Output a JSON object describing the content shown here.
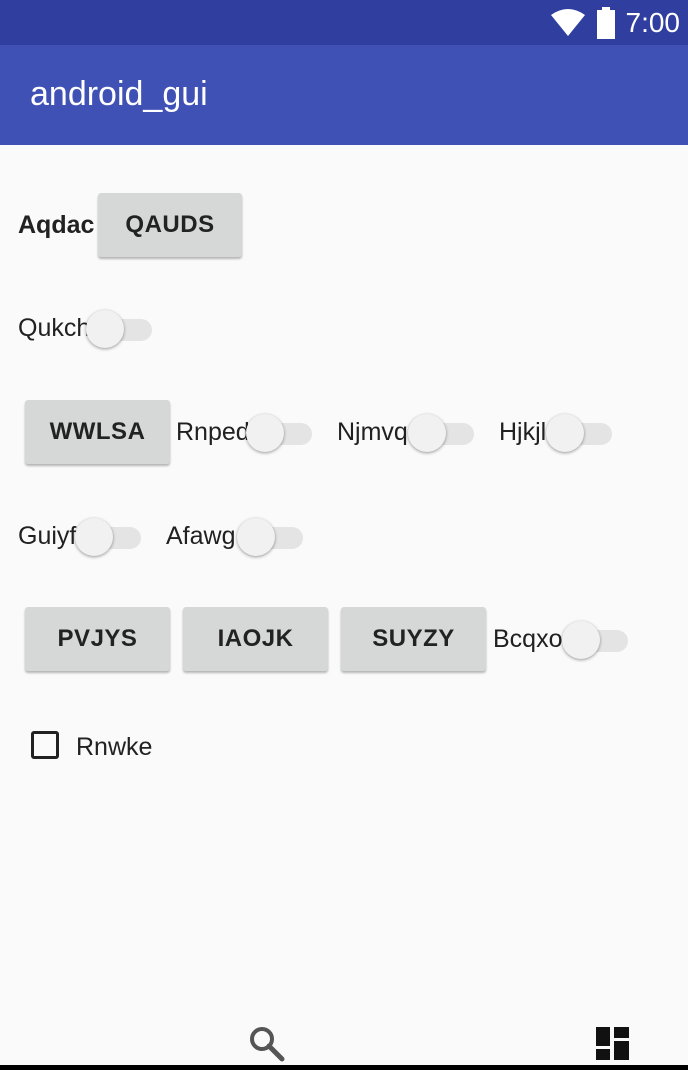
{
  "status_bar": {
    "time": "7:00",
    "icons": [
      "wifi-icon",
      "battery-icon"
    ]
  },
  "app_bar": {
    "title": "android_gui"
  },
  "row1": {
    "label": "Aqdac",
    "button": "QAUDS"
  },
  "row2": {
    "switch_label": "Qukch",
    "switch_on": false
  },
  "row3": {
    "button": "WWLSA",
    "switches": [
      {
        "label": "Rnped",
        "on": false
      },
      {
        "label": "Njmvq",
        "on": false
      },
      {
        "label": "Hjkjl",
        "on": false
      }
    ]
  },
  "row4": {
    "switches": [
      {
        "label": "Guiyf",
        "on": false
      },
      {
        "label": "Afawg",
        "on": false
      }
    ]
  },
  "row5": {
    "buttons": [
      "PVJYS",
      "IAOJK",
      "SUYZY"
    ],
    "switch": {
      "label": "Bcqxo",
      "on": false
    }
  },
  "row6": {
    "checkbox_label": "Rnwke",
    "checked": false
  },
  "bottom_nav": {
    "icons": [
      "search-icon",
      "dashboard-icon"
    ]
  },
  "colors": {
    "status_bar": "#303f9f",
    "app_bar": "#3f51b5",
    "button": "#d6d7d7",
    "background": "#fafafa"
  }
}
